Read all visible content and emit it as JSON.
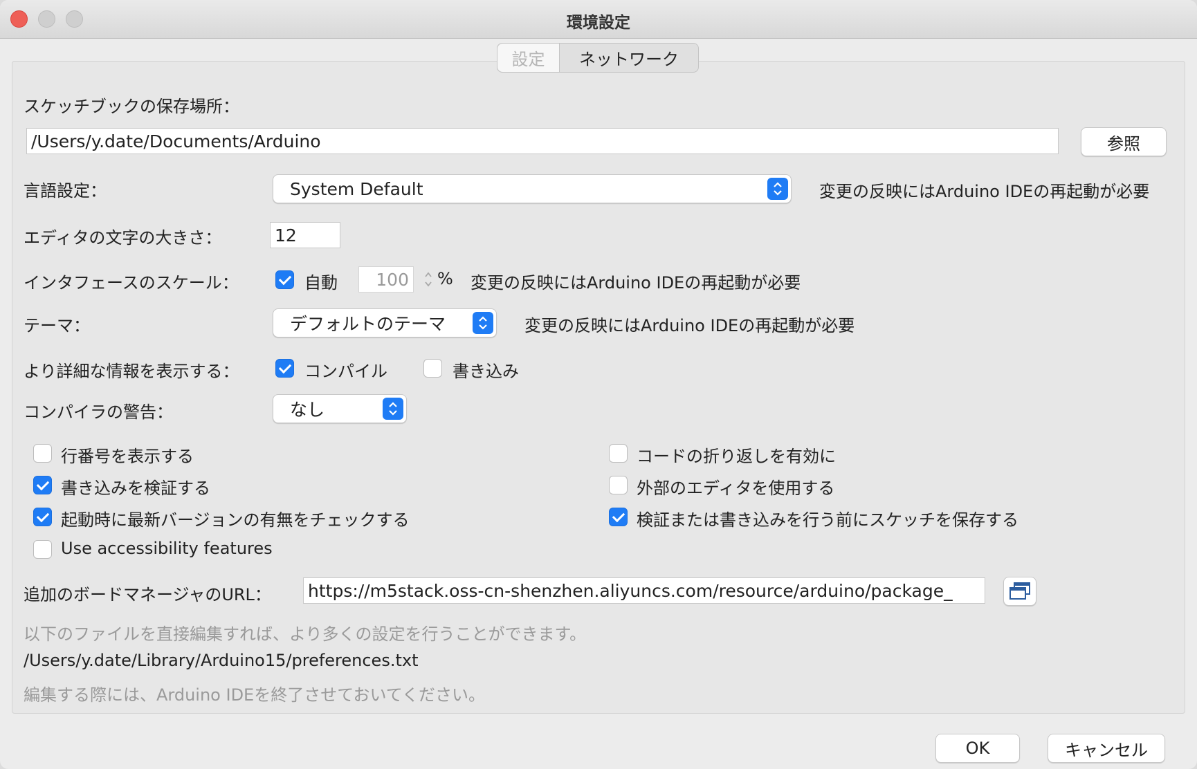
{
  "window": {
    "title": "環境設定"
  },
  "tabs": [
    {
      "label": "設定"
    },
    {
      "label": "ネットワーク"
    }
  ],
  "sketchbook": {
    "label": "スケッチブックの保存場所：",
    "path": "/Users/y.date/Documents/Arduino",
    "browse_label": "参照"
  },
  "language": {
    "label": "言語設定：",
    "value": "System Default",
    "note": "変更の反映にはArduino IDEの再起動が必要"
  },
  "font_size": {
    "label": "エディタの文字の大きさ：",
    "value": "12"
  },
  "scale": {
    "label": "インタフェースのスケール：",
    "auto_label": "自動",
    "auto_checked": true,
    "value": "100",
    "unit": "%",
    "note": "変更の反映にはArduino IDEの再起動が必要"
  },
  "theme": {
    "label": "テーマ：",
    "value": "デフォルトのテーマ",
    "note": "変更の反映にはArduino IDEの再起動が必要"
  },
  "verbose": {
    "label": "より詳細な情報を表示する：",
    "compile_label": "コンパイル",
    "compile_checked": true,
    "upload_label": "書き込み",
    "upload_checked": false
  },
  "warnings": {
    "label": "コンパイラの警告：",
    "value": "なし"
  },
  "options_left": [
    {
      "label": "行番号を表示する",
      "checked": false
    },
    {
      "label": "書き込みを検証する",
      "checked": true
    },
    {
      "label": "起動時に最新バージョンの有無をチェックする",
      "checked": true
    },
    {
      "label": "Use accessibility features",
      "checked": false
    }
  ],
  "options_right": [
    {
      "label": "コードの折り返しを有効に",
      "checked": false
    },
    {
      "label": "外部のエディタを使用する",
      "checked": false
    },
    {
      "label": "検証または書き込みを行う前にスケッチを保存する",
      "checked": true
    }
  ],
  "board_urls": {
    "label": "追加のボードマネージャのURL：",
    "value": "https://m5stack.oss-cn-shenzhen.aliyuncs.com/resource/arduino/package_"
  },
  "info": {
    "line1": "以下のファイルを直接編集すれば、より多くの設定を行うことができます。",
    "path": "/Users/y.date/Library/Arduino15/preferences.txt",
    "line2": "編集する際には、Arduino IDEを終了させておいてください。"
  },
  "buttons": {
    "ok_label": "OK",
    "cancel_label": "キャンセル"
  },
  "colors": {
    "accent": "#1f7cf5",
    "close": "#ee5f57"
  }
}
